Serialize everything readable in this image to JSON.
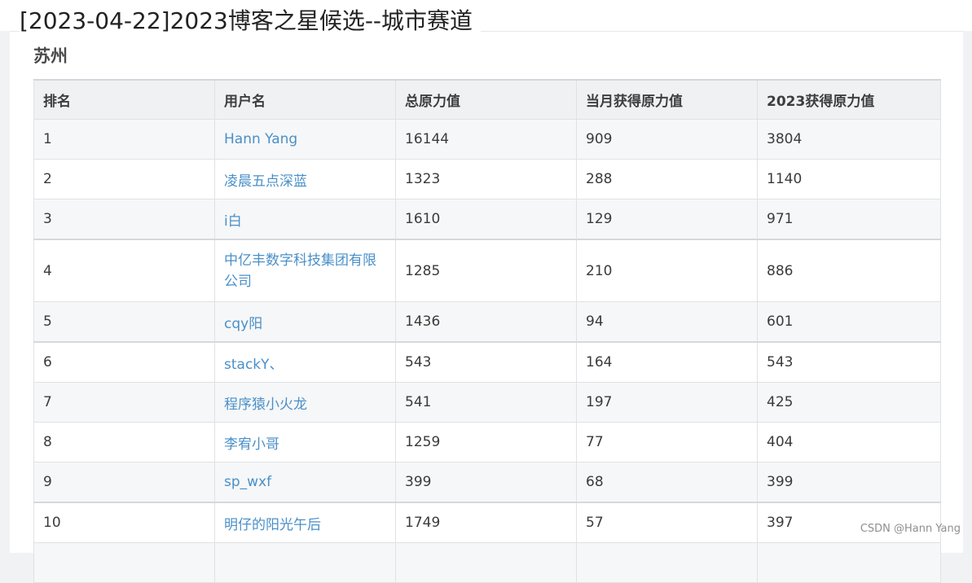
{
  "title": "[2023-04-22]2023博客之星候选--城市赛道",
  "city": "苏州",
  "table": {
    "headers": [
      "排名",
      "用户名",
      "总原力值",
      "当月获得原力值",
      "2023获得原力值"
    ],
    "rows": [
      {
        "rank": "1",
        "user": "Hann Yang",
        "total": "16144",
        "month": "909",
        "year": "3804"
      },
      {
        "rank": "2",
        "user": "凌晨五点深蓝",
        "total": "1323",
        "month": "288",
        "year": "1140"
      },
      {
        "rank": "3",
        "user": "i白",
        "total": "1610",
        "month": "129",
        "year": "971"
      },
      {
        "rank": "4",
        "user": "中亿丰数字科技集团有限公司",
        "total": "1285",
        "month": "210",
        "year": "886"
      },
      {
        "rank": "5",
        "user": "cqy阳",
        "total": "1436",
        "month": "94",
        "year": "601"
      },
      {
        "rank": "6",
        "user": "stackY、",
        "total": "543",
        "month": "164",
        "year": "543"
      },
      {
        "rank": "7",
        "user": "程序猿小火龙",
        "total": "541",
        "month": "197",
        "year": "425"
      },
      {
        "rank": "8",
        "user": "李宥小哥",
        "total": "1259",
        "month": "77",
        "year": "404"
      },
      {
        "rank": "9",
        "user": "sp_wxf",
        "total": "399",
        "month": "68",
        "year": "399"
      },
      {
        "rank": "10",
        "user": "明仔的阳光午后",
        "total": "1749",
        "month": "57",
        "year": "397"
      }
    ]
  },
  "watermark": "CSDN @Hann Yang",
  "colors": {
    "link": "#4a90c8",
    "header_bg": "#eff1f3",
    "stripe_bg": "#f6f7f8"
  }
}
